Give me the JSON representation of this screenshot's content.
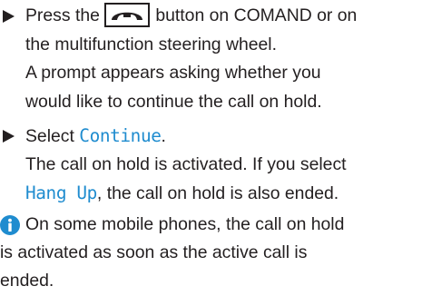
{
  "steps": [
    {
      "line1_before": "Press the",
      "button_icon": "phone-hang-up-icon",
      "line1_after": "button on COMAND or on",
      "line2": "the multifunction steering wheel.",
      "result_line1": "A prompt appears asking whether you",
      "result_line2": "would like to continue the call on hold."
    },
    {
      "line1_before": "Select",
      "option": "Continue",
      "line1_after": ".",
      "result_line1_before": "The call on hold is activated. If you select",
      "result_option": "Hang Up",
      "result_line2_after": ", the call on hold is also ended."
    }
  ],
  "note": {
    "icon": "info-icon",
    "line1": "On some mobile phones, the call on hold",
    "line2": "is activated as soon as the active call is",
    "line3": "ended."
  },
  "colors": {
    "text": "#231f20",
    "highlight": "#1f8ccf"
  }
}
